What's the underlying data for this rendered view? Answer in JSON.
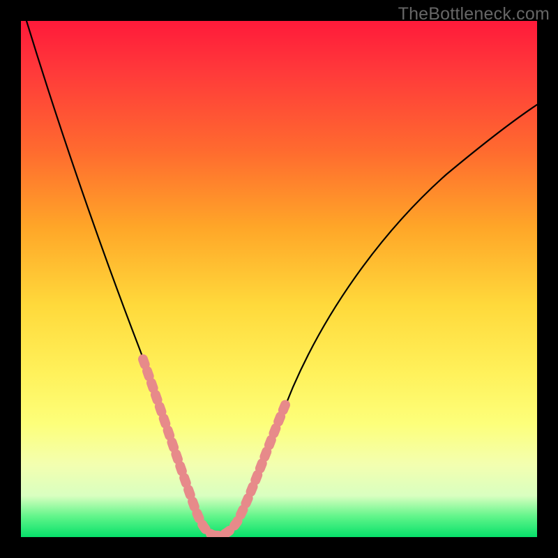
{
  "watermark": "TheBottleneck.com",
  "chart_data": {
    "type": "line",
    "title": "",
    "xlabel": "",
    "ylabel": "",
    "xlim": [
      0,
      100
    ],
    "ylim": [
      0,
      100
    ],
    "grid": false,
    "legend": false,
    "background_gradient": {
      "orientation": "vertical",
      "stops": [
        {
          "pos": 0,
          "color": "#ff1a3a"
        },
        {
          "pos": 25,
          "color": "#ff6a2f"
        },
        {
          "pos": 55,
          "color": "#ffd93b"
        },
        {
          "pos": 80,
          "color": "#fdff7a"
        },
        {
          "pos": 96,
          "color": "#61f58a"
        },
        {
          "pos": 100,
          "color": "#06e06a"
        }
      ]
    },
    "series": [
      {
        "name": "bottleneck_curve",
        "color": "#000000",
        "x": [
          1,
          4,
          8,
          13,
          18,
          22,
          25,
          28,
          30,
          32,
          34,
          36,
          38,
          40,
          44,
          48,
          52,
          58,
          65,
          73,
          82,
          91,
          100
        ],
        "y": [
          100,
          88,
          74,
          58,
          44,
          32,
          22,
          12,
          6,
          2,
          0,
          0,
          2,
          6,
          14,
          24,
          34,
          44,
          52,
          58,
          62,
          66,
          70
        ]
      },
      {
        "name": "highlight_markers",
        "color": "#e78a8a",
        "style": "dashed-thick",
        "x": [
          22,
          24,
          26,
          28,
          30,
          32,
          34,
          36,
          38,
          40,
          42,
          44,
          46
        ],
        "y": [
          32,
          24,
          18,
          12,
          6,
          2,
          0,
          0,
          2,
          6,
          12,
          18,
          24
        ]
      }
    ],
    "annotations": []
  }
}
